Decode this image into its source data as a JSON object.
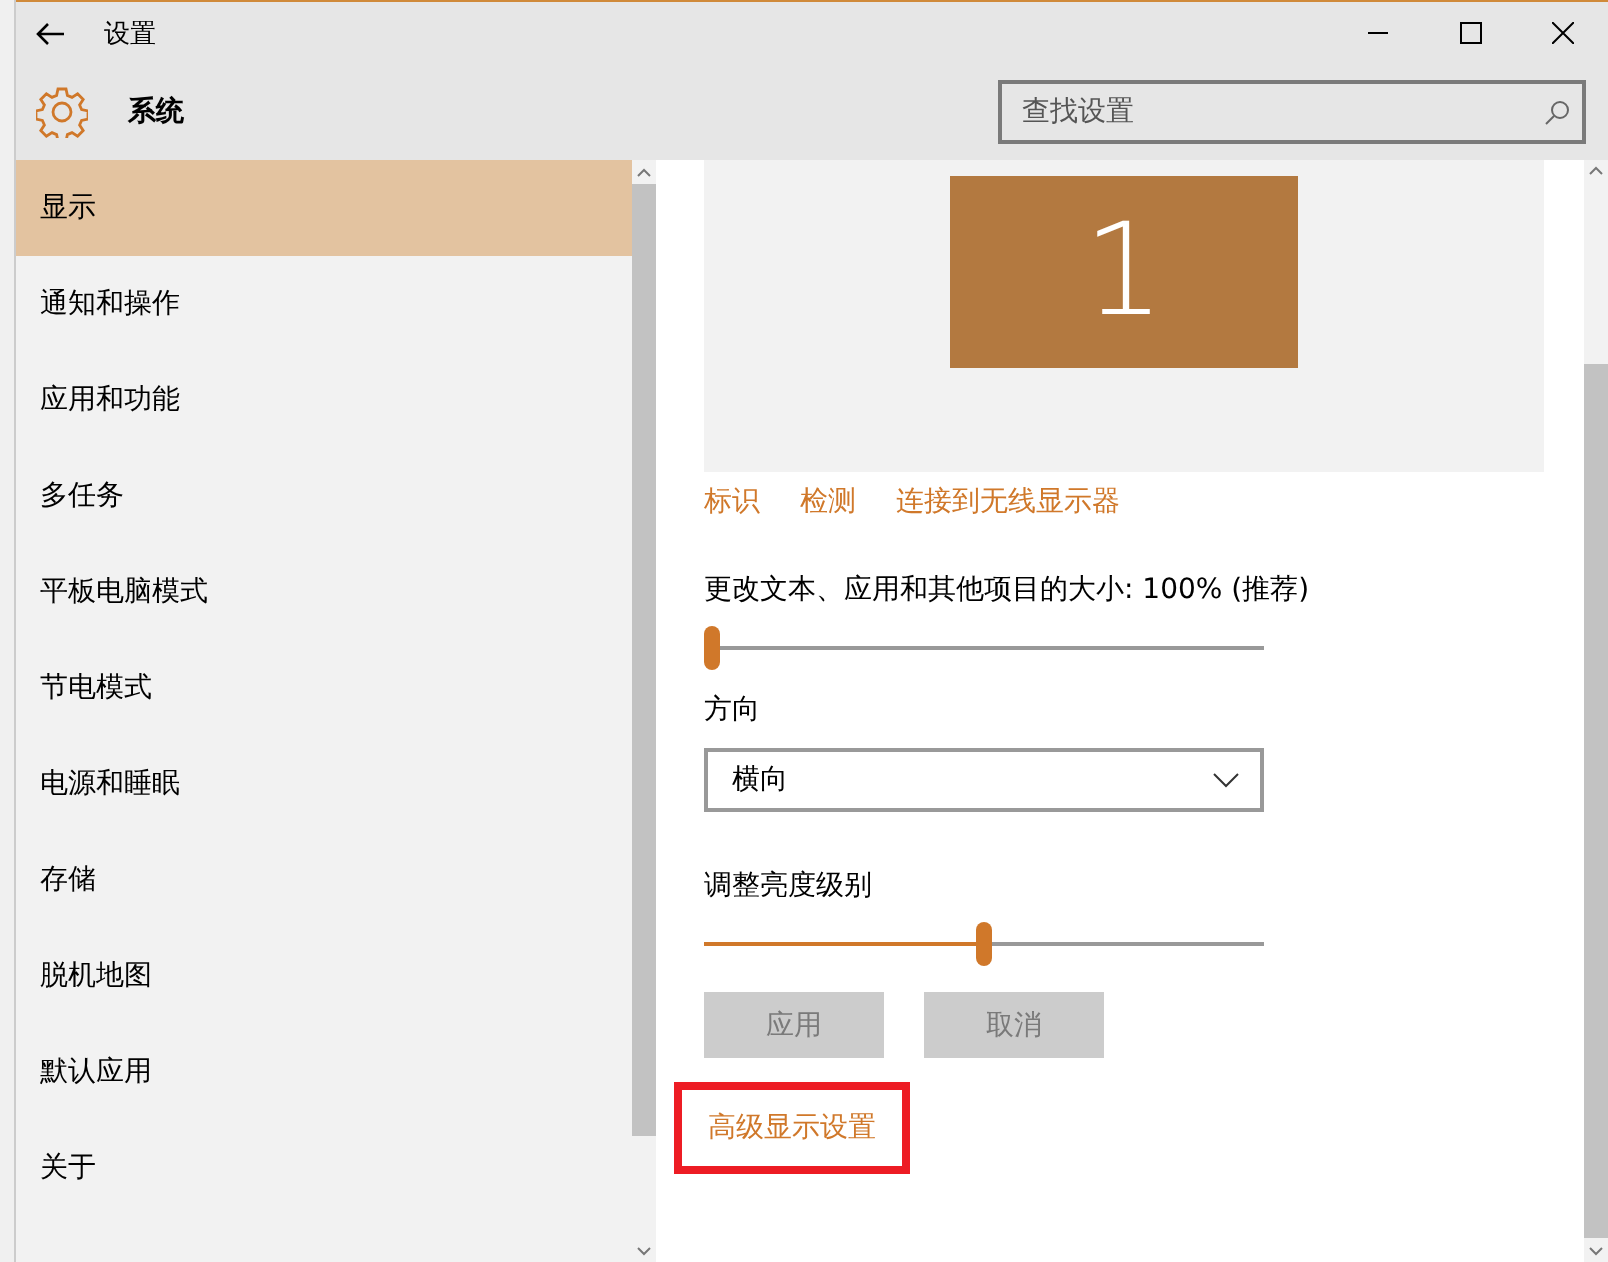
{
  "window": {
    "title": "设置"
  },
  "header": {
    "title": "系统",
    "search": {
      "placeholder": "查找设置"
    }
  },
  "sidebar": {
    "items": [
      {
        "label": "显示",
        "selected": true
      },
      {
        "label": "通知和操作",
        "selected": false
      },
      {
        "label": "应用和功能",
        "selected": false
      },
      {
        "label": "多任务",
        "selected": false
      },
      {
        "label": "平板电脑模式",
        "selected": false
      },
      {
        "label": "节电模式",
        "selected": false
      },
      {
        "label": "电源和睡眠",
        "selected": false
      },
      {
        "label": "存储",
        "selected": false
      },
      {
        "label": "脱机地图",
        "selected": false
      },
      {
        "label": "默认应用",
        "selected": false
      },
      {
        "label": "关于",
        "selected": false
      }
    ]
  },
  "display": {
    "monitor": {
      "label": "1"
    },
    "links": [
      "标识",
      "检测",
      "连接到无线显示器"
    ],
    "scale": {
      "label": "更改文本、应用和其他项目的大小: 100% (推荐)",
      "level": 0
    },
    "orientation": {
      "label": "方向",
      "value": "横向"
    },
    "brightness": {
      "label": "调整亮度级别",
      "level": 0.5
    },
    "buttons": [
      {
        "label": "应用",
        "disabled": true
      },
      {
        "label": "取消",
        "disabled": true
      }
    ],
    "advanced_link": {
      "label": "高级显示设置",
      "highlighted": true
    }
  }
}
